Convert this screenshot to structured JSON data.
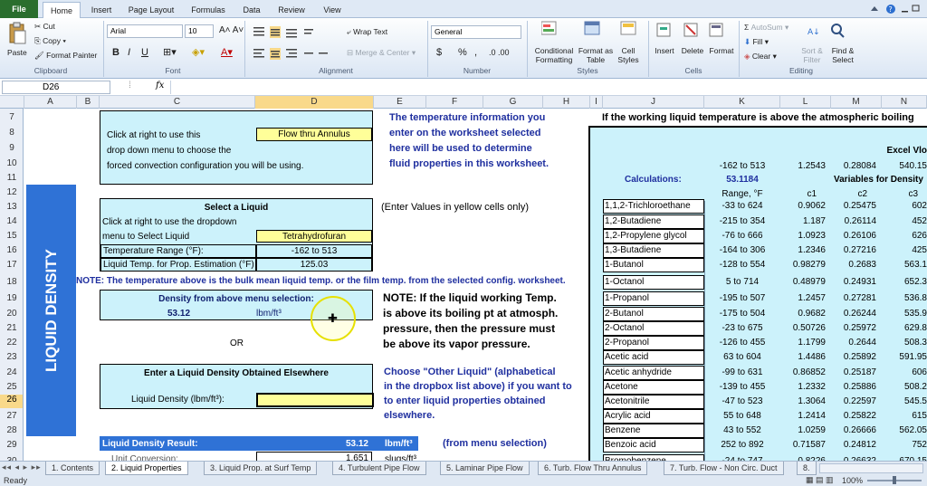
{
  "ribbon_tabs": [
    "File",
    "Home",
    "Insert",
    "Page Layout",
    "Formulas",
    "Data",
    "Review",
    "View"
  ],
  "clipboard": {
    "paste": "Paste",
    "cut": "Cut",
    "copy": "Copy",
    "format_painter": "Format Painter",
    "group": "Clipboard"
  },
  "font": {
    "name": "Arial",
    "size": "10",
    "group": "Font",
    "bold": "B",
    "italic": "I",
    "underline": "U"
  },
  "alignment": {
    "wrap": "Wrap Text",
    "merge": "Merge & Center",
    "group": "Alignment"
  },
  "number": {
    "format": "General",
    "currency": "$",
    "percent": "%",
    "comma": ",",
    "group": "Number"
  },
  "styles": {
    "cond": "Conditional Formatting",
    "table": "Format as Table",
    "cell": "Cell Styles",
    "group": "Styles"
  },
  "cells": {
    "insert": "Insert",
    "delete": "Delete",
    "format": "Format",
    "group": "Cells"
  },
  "editing": {
    "autosum": "AutoSum",
    "fill": "Fill",
    "clear": "Clear",
    "sort": "Sort & Filter",
    "find": "Find & Select",
    "group": "Editing"
  },
  "formula_bar": {
    "name_box": "D26",
    "fx": "fx",
    "value": ""
  },
  "columns": [
    "A",
    "B",
    "C",
    "D",
    "E",
    "F",
    "G",
    "H",
    "I",
    "J",
    "K",
    "L",
    "M",
    "N"
  ],
  "rows": [
    "7",
    "8",
    "9",
    "10",
    "11",
    "12",
    "13",
    "14",
    "15",
    "16",
    "17",
    "18",
    "19",
    "20",
    "21",
    "22",
    "23",
    "24",
    "25",
    "26",
    "27",
    "28",
    "29",
    "30"
  ],
  "side_label": "LIQUID DENSITY",
  "config": {
    "line1": "Click at right to use this",
    "line2": "drop down menu to choose the",
    "line3": "forced convection configuration you will be using.",
    "value": "Flow thru Annulus"
  },
  "temp_info": {
    "line1": "The temperature information you",
    "line2": "enter on the worksheet selected",
    "line3": "here will be used to determine",
    "line4": "fluid properties in this worksheet."
  },
  "select_liquid": {
    "title": "Select a Liquid",
    "line1": "Click at right to use the dropdown",
    "line2": "menu to Select Liquid",
    "liquid": "Tetrahydrofuran",
    "range_label": "Temperature Range (°F):",
    "range_value": "-162 to 513",
    "temp_label": "Liquid Temp. for Prop. Estimation (°F)",
    "temp_value": "125.03",
    "hint": "(Enter Values in yellow cells only)"
  },
  "note1": "NOTE:  The temperature above is the bulk mean liquid temp. or the film temp. from the selected config. worksheet.",
  "density_sel": {
    "title": "Density from above menu selection:",
    "value": "53.12",
    "unit": "lbm/ft³"
  },
  "or": "OR",
  "note2": {
    "line1": "NOTE:  If the liquid working Temp.",
    "line2": "is above its boiling pt at atmosph.",
    "line3": "pressure, then the pressure must",
    "line4": "be above its vapor pressure."
  },
  "other": {
    "title": "Enter a Liquid Density Obtained Elsewhere",
    "label": "Liquid Density (lbm/ft³):",
    "hint1": "Choose \"Other Liquid\" (alphabetical",
    "hint2": "in the dropbox list above) if you want to",
    "hint3": "to enter liquid properties obtained",
    "hint4": "elsewhere."
  },
  "result": {
    "label": "Liquid Density Result:",
    "value": "53.12",
    "unit": "lbm/ft³",
    "src": "(from menu selection)",
    "conv_label": "Unit Conversion:",
    "conv_value": "1.651",
    "conv_unit": "slugs/ft³"
  },
  "right": {
    "header": "If the working liquid temperature is above the atmospheric boiling",
    "excel": "Excel Vlo",
    "range": "-162 to 513",
    "c1v": "1.2543",
    "c2v": "0.28084",
    "c3v": "540.15",
    "calc_label": "Calculations:",
    "calc_value": "53.1184",
    "vars": "Variables for Density",
    "col_range": "Range, °F",
    "c1": "c1",
    "c2": "c2",
    "c3": "c3"
  },
  "liquids": [
    [
      "1,1,2-Trichloroethane",
      "-33 to 624",
      "0.9062",
      "0.25475",
      "602"
    ],
    [
      "1,2-Butadiene",
      "-215 to 354",
      "1.187",
      "0.26114",
      "452"
    ],
    [
      "1,2-Propylene glycol",
      "-76 to 666",
      "1.0923",
      "0.26106",
      "626"
    ],
    [
      "1,3-Butadiene",
      "-164 to 306",
      "1.2346",
      "0.27216",
      "425"
    ],
    [
      "1-Butanol",
      "-128 to 554",
      "0.98279",
      "0.2683",
      "563.1"
    ],
    [
      "1-Octanol",
      "5 to 714",
      "0.48979",
      "0.24931",
      "652.3"
    ],
    [
      "1-Propanol",
      "-195 to 507",
      "1.2457",
      "0.27281",
      "536.8"
    ],
    [
      "2-Butanol",
      "-175 to 504",
      "0.9682",
      "0.26244",
      "535.9"
    ],
    [
      "2-Octanol",
      "-23 to 675",
      "0.50726",
      "0.25972",
      "629.8"
    ],
    [
      "2-Propanol",
      "-126 to 455",
      "1.1799",
      "0.2644",
      "508.3"
    ],
    [
      "Acetic acid",
      "63 to 604",
      "1.4486",
      "0.25892",
      "591.95"
    ],
    [
      "Acetic anhydride",
      "-99 to 631",
      "0.86852",
      "0.25187",
      "606"
    ],
    [
      "Acetone",
      "-139 to 455",
      "1.2332",
      "0.25886",
      "508.2"
    ],
    [
      "Acetonitrile",
      "-47 to 523",
      "1.3064",
      "0.22597",
      "545.5"
    ],
    [
      "Acrylic acid",
      "55 to 648",
      "1.2414",
      "0.25822",
      "615"
    ],
    [
      "Benzene",
      "43 to 552",
      "1.0259",
      "0.26666",
      "562.05"
    ],
    [
      "Benzoic acid",
      "252 to 892",
      "0.71587",
      "0.24812",
      "752"
    ],
    [
      "Bromobenzene",
      "-24 to 747",
      "0.8226",
      "0.26632",
      "670.15"
    ]
  ],
  "sheet_tabs": [
    "1. Contents",
    "2. Liquid Properties",
    "3. Liquid Prop. at Surf Temp",
    "4. Turbulent Pipe Flow",
    "5. Laminar Pipe Flow",
    "6. Turb. Flow Thru Annulus",
    "7. Turb. Flow - Non Circ. Duct",
    "8."
  ],
  "status": "Ready",
  "zoom": "100%",
  "colors": {
    "cyan": "#ccf2fb",
    "yellow": "#ffff99",
    "blue_band": "#2f72d6",
    "dark_blue": "#1f2f9f"
  }
}
